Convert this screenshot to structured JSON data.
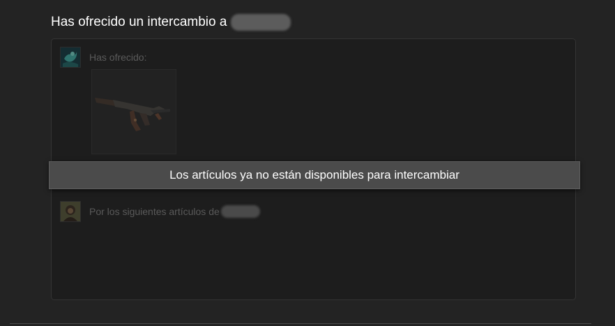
{
  "header": {
    "title": "Has ofrecido un intercambio a"
  },
  "offer": {
    "label": "Has ofrecido:",
    "item_icon": "rifle-icon"
  },
  "receive": {
    "label": "Por los siguientes artículos de"
  },
  "banner": {
    "message": "Los artículos ya no están disponibles para intercambiar"
  },
  "colors": {
    "background": "#232323",
    "panel": "#1d1d1d",
    "banner": "#4b4b4b",
    "muted_text": "#5a5a5a",
    "redaction": "#5c5c5c"
  }
}
